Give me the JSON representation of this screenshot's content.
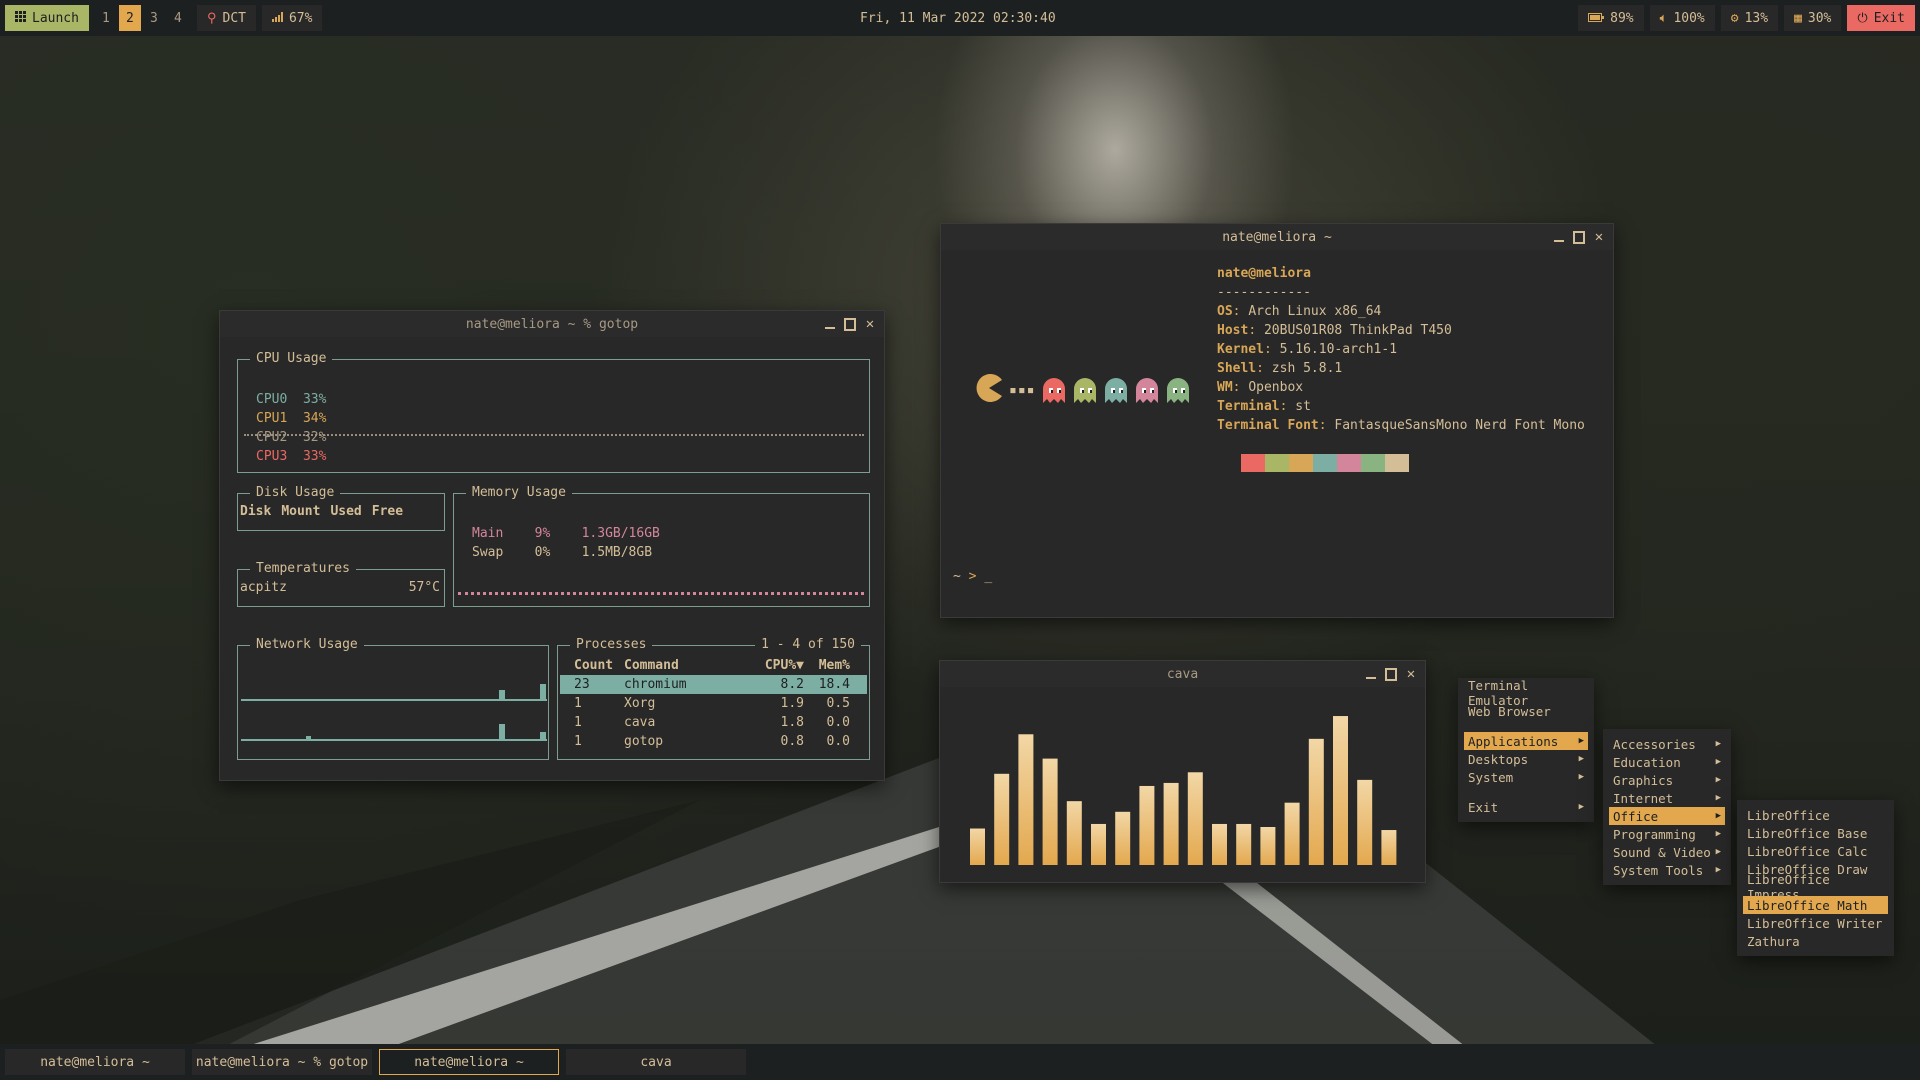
{
  "topbar": {
    "launch_label": "Launch",
    "workspaces": [
      "1",
      "2",
      "3",
      "4"
    ],
    "active_workspace": "2",
    "dct_label": "DCT",
    "signal_label": "67%",
    "clock": "Fri, 11 Mar 2022 02:30:40",
    "battery": "89%",
    "volume": "100%",
    "cpu": "13%",
    "memory": "30%",
    "exit_label": "Exit"
  },
  "gotop": {
    "title": "nate@meliora ~ % gotop",
    "cpu_box": "CPU Usage",
    "cpus": [
      {
        "name": "CPU0",
        "value": "33%",
        "color": "#7daea3"
      },
      {
        "name": "CPU1",
        "value": "34%",
        "color": "#d8a657"
      },
      {
        "name": "CPU2",
        "value": "32%",
        "color": "#a89984"
      },
      {
        "name": "CPU3",
        "value": "33%",
        "color": "#ea6962"
      }
    ],
    "disk_box": "Disk Usage",
    "disk_headers": [
      "Disk",
      "Mount",
      "Used",
      "Free"
    ],
    "temp_box": "Temperatures",
    "temp_sensor": "acpitz",
    "temp_value": "57°C",
    "mem_box": "Memory Usage",
    "mem_rows": [
      {
        "name": "Main",
        "pct": "9%",
        "val": "1.3GB/16GB"
      },
      {
        "name": "Swap",
        "pct": "0%",
        "val": "1.5MB/8GB"
      }
    ],
    "net_box": "Network Usage",
    "proc_box": "Processes",
    "proc_range": "1 - 4 of 150",
    "proc_headers": [
      "Count",
      "Command",
      "CPU%▼",
      "Mem%"
    ],
    "procs": [
      {
        "count": "23",
        "cmd": "chromium",
        "cpu": "8.2",
        "mem": "18.4"
      },
      {
        "count": "1",
        "cmd": "Xorg",
        "cpu": "1.9",
        "mem": "0.5"
      },
      {
        "count": "1",
        "cmd": "cava",
        "cpu": "1.8",
        "mem": "0.0"
      },
      {
        "count": "1",
        "cmd": "gotop",
        "cpu": "0.8",
        "mem": "0.0"
      }
    ]
  },
  "fetch": {
    "title": "nate@meliora ~",
    "user": "nate@meliora",
    "sep": "------------",
    "rows": [
      {
        "k": "OS",
        "v": "Arch Linux x86_64"
      },
      {
        "k": "Host",
        "v": "20BUS01R08 ThinkPad T450"
      },
      {
        "k": "Kernel",
        "v": "5.16.10-arch1-1"
      },
      {
        "k": "Shell",
        "v": "zsh 5.8.1"
      },
      {
        "k": "WM",
        "v": "Openbox"
      },
      {
        "k": "Terminal",
        "v": "st"
      },
      {
        "k": "Terminal Font",
        "v": "FantasqueSansMono Nerd Font Mono"
      }
    ],
    "palette": [
      "#282828",
      "#ea6962",
      "#a9b665",
      "#d8a657",
      "#7daea3",
      "#d3869b",
      "#89b482",
      "#d4be98"
    ],
    "prompt_dir": "~",
    "prompt_arrow": ">",
    "cursor": "_",
    "ghost_colors": [
      "#ea6962",
      "#a9b665",
      "#7daea3",
      "#d3869b",
      "#89b482"
    ]
  },
  "cava": {
    "title": "cava",
    "levels": [
      0.24,
      0.6,
      0.86,
      0.7,
      0.42,
      0.27,
      0.35,
      0.52,
      0.54,
      0.61,
      0.27,
      0.27,
      0.25,
      0.41,
      0.83,
      0.98,
      0.56,
      0.23
    ]
  },
  "menu_root": {
    "items": [
      "Terminal Emulator",
      "Web Browser",
      "Applications",
      "Desktops",
      "System",
      "Exit"
    ]
  },
  "menu_apps": {
    "items": [
      "Accessories",
      "Education",
      "Graphics",
      "Internet",
      "Office",
      "Programming",
      "Sound & Video",
      "System Tools"
    ]
  },
  "menu_office": {
    "items": [
      "LibreOffice",
      "LibreOffice Base",
      "LibreOffice Calc",
      "LibreOffice Draw",
      "LibreOffice Impress",
      "LibreOffice Math",
      "LibreOffice Writer",
      "Zathura"
    ]
  },
  "taskbar": {
    "tasks": [
      "nate@meliora ~",
      "nate@meliora ~ % gotop",
      "nate@meliora ~",
      "cava"
    ]
  },
  "colors": {
    "accent": "#e3a84e",
    "green": "#a9b665",
    "red": "#ea6962",
    "aqua": "#7daea3",
    "bg": "#282828"
  }
}
